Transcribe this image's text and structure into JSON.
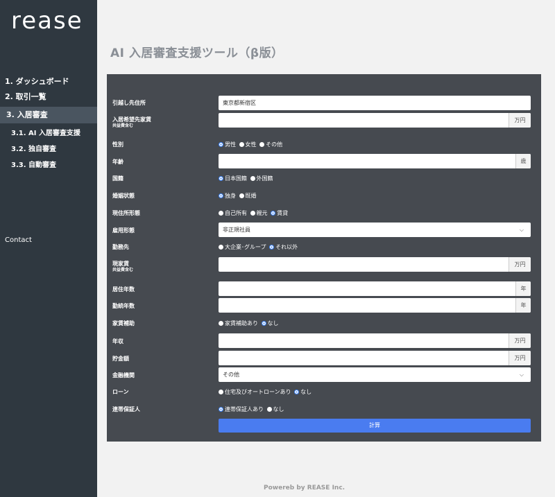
{
  "brand": {
    "logo": "rease"
  },
  "sidebar": {
    "items": [
      {
        "label": "1. ダッシュボード"
      },
      {
        "label": "2. 取引一覧"
      },
      {
        "label": "3. 入居審査"
      }
    ],
    "subitems": [
      {
        "label": "3.1. AI 入居審査支援"
      },
      {
        "label": "3.2. 独自審査"
      },
      {
        "label": "3.3. 自動審査"
      }
    ],
    "contact": "Contact"
  },
  "page": {
    "title": "AI 入居審査支援ツール（β版）"
  },
  "form": {
    "address": {
      "label": "引越し先住所",
      "value": "東京都新宿区"
    },
    "rent": {
      "label": "入居希望先家賃",
      "sublabel": "共益費含む",
      "value": "",
      "unit": "万円"
    },
    "gender": {
      "label": "性別",
      "options": [
        "男性",
        "女性",
        "その他"
      ]
    },
    "age": {
      "label": "年齢",
      "value": "",
      "unit": "歳"
    },
    "nationality": {
      "label": "国籍",
      "options": [
        "日本国籍",
        "外国籍"
      ]
    },
    "marital": {
      "label": "婚姻状態",
      "options": [
        "独身",
        "既婚"
      ]
    },
    "residence_type": {
      "label": "現住所形態",
      "options": [
        "自己所有",
        "親元",
        "賃貸"
      ]
    },
    "employment": {
      "label": "雇用形態",
      "value": "非正規社員"
    },
    "workplace": {
      "label": "勤務先",
      "options": [
        "大企業･グループ",
        "それ以外"
      ]
    },
    "current_rent": {
      "label": "現家賃",
      "sublabel": "共益費含む",
      "value": "",
      "unit": "万円"
    },
    "years_residence": {
      "label": "居住年数",
      "value": "",
      "unit": "年"
    },
    "years_employment": {
      "label": "勤続年数",
      "value": "",
      "unit": "年"
    },
    "rent_subsidy": {
      "label": "家賃補助",
      "options": [
        "家賃補助あり",
        "なし"
      ]
    },
    "income": {
      "label": "年収",
      "value": "",
      "unit": "万円"
    },
    "savings": {
      "label": "貯金額",
      "value": "",
      "unit": "万円"
    },
    "bank": {
      "label": "金融機関",
      "value": "その他"
    },
    "loan": {
      "label": "ローン",
      "options": [
        "住宅及びオートローンあり",
        "なし"
      ]
    },
    "guarantor": {
      "label": "連帯保証人",
      "options": [
        "連帯保証人あり",
        "なし"
      ]
    },
    "submit_label": "計算"
  },
  "footer": {
    "text": "Powereb by REASE Inc."
  }
}
